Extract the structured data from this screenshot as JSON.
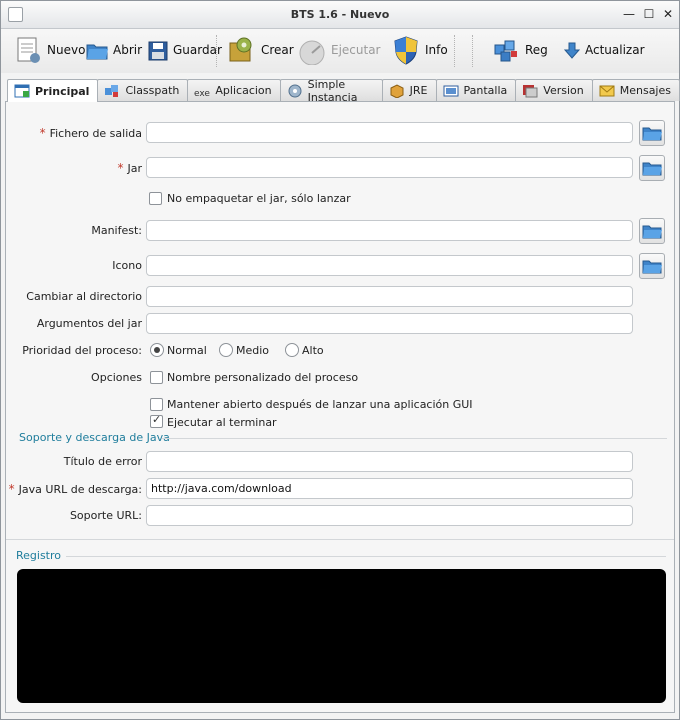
{
  "window": {
    "title": "BTS 1.6 - Nuevo",
    "controls": {
      "minimize": "—",
      "maximize": "☐",
      "close": "✕"
    }
  },
  "toolbar": {
    "new_label": "Nuevo",
    "open_label": "Abrir",
    "save_label": "Guardar",
    "create_label": "Crear",
    "run_label": "Ejecutar",
    "info_label": "Info",
    "reg_label": "Reg",
    "update_label": "Actualizar"
  },
  "tabs": [
    {
      "label": "Principal",
      "icon": "main-tab-icon",
      "active": true
    },
    {
      "label": "Classpath",
      "icon": "classpath-icon"
    },
    {
      "label": "Aplicacion",
      "icon": "exe-icon"
    },
    {
      "label": "Simple Instancia",
      "icon": "instance-icon"
    },
    {
      "label": "JRE",
      "icon": "jre-icon"
    },
    {
      "label": "Pantalla",
      "icon": "screen-icon"
    },
    {
      "label": "Version",
      "icon": "version-icon"
    },
    {
      "label": "Mensajes",
      "icon": "mail-icon"
    }
  ],
  "form": {
    "output_file_label": "Fichero de salida",
    "output_file_value": "",
    "jar_label": "Jar",
    "jar_value": "",
    "no_wrap_label": "No empaquetar el jar, sólo lanzar",
    "manifest_label": "Manifest:",
    "manifest_value": "",
    "icon_label": "Icono",
    "icon_value": "",
    "chdir_label": "Cambiar al directorio",
    "chdir_value": "",
    "args_label": "Argumentos del jar",
    "args_value": "",
    "priority_label": "Prioridad del proceso:",
    "priority_options": [
      "Normal",
      "Medio",
      "Alto"
    ],
    "options_label": "Opciones",
    "custom_name_label": "Nombre personalizado del proceso",
    "stay_alive_label": "Mantener abierto después de lanzar una aplicación GUI",
    "run_after_label": "Ejecutar al terminar",
    "required_mark": "*"
  },
  "java_section": {
    "title": "Soporte y descarga de Java",
    "error_title_label": "Título de error",
    "error_title_value": "",
    "download_url_label": "Java URL de descarga:",
    "download_url_value": "http://java.com/download",
    "support_url_label": "Soporte URL:",
    "support_url_value": ""
  },
  "log_section": {
    "title": "Registro"
  },
  "colors": {
    "accent": "#1f7d9c",
    "required": "#c0392b",
    "log_background": "#000000"
  }
}
